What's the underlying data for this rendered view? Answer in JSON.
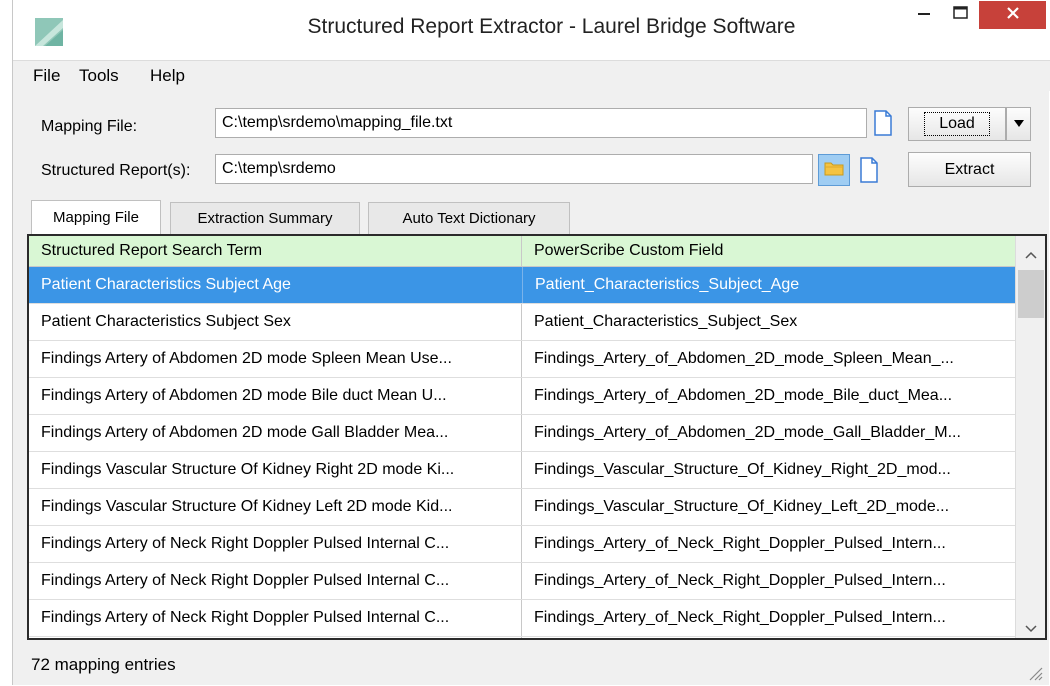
{
  "window": {
    "title": "Structured Report Extractor - Laurel Bridge Software",
    "icons": {
      "app": "laurel-bridge-logo-icon",
      "minimize": "minimize-icon",
      "maximize": "maximize-icon",
      "close": "close-icon"
    }
  },
  "menu": [
    "File",
    "Tools",
    "Help"
  ],
  "mapping_file": {
    "label": "Mapping File:",
    "value": "C:\\temp\\srdemo\\mapping_file.txt",
    "load_label": "Load"
  },
  "structured_reports": {
    "label": "Structured Report(s):",
    "value": "C:\\temp\\srdemo",
    "extract_label": "Extract"
  },
  "tabs": [
    "Mapping File",
    "Extraction Summary",
    "Auto Text Dictionary"
  ],
  "table": {
    "columns": [
      "Structured Report Search Term",
      "PowerScribe Custom Field"
    ],
    "rows": [
      [
        "Patient Characteristics Subject Age",
        "Patient_Characteristics_Subject_Age"
      ],
      [
        "Patient Characteristics Subject Sex",
        "Patient_Characteristics_Subject_Sex"
      ],
      [
        "Findings Artery of Abdomen  2D mode   Spleen Mean Use...",
        "Findings_Artery_of_Abdomen_2D_mode_Spleen_Mean_..."
      ],
      [
        "Findings Artery of Abdomen  2D mode   Bile duct Mean U...",
        "Findings_Artery_of_Abdomen_2D_mode_Bile_duct_Mea..."
      ],
      [
        "Findings Artery of Abdomen  2D mode   Gall Bladder Mea...",
        "Findings_Artery_of_Abdomen_2D_mode_Gall_Bladder_M..."
      ],
      [
        "Findings Vascular Structure Of Kidney Right  2D mode   Ki...",
        "Findings_Vascular_Structure_Of_Kidney_Right_2D_mod..."
      ],
      [
        "Findings Vascular Structure Of Kidney Left 2D mode   Kid...",
        "Findings_Vascular_Structure_Of_Kidney_Left_2D_mode..."
      ],
      [
        "Findings Artery of Neck Right  Doppler Pulsed  Internal C...",
        "Findings_Artery_of_Neck_Right_Doppler_Pulsed_Intern..."
      ],
      [
        "Findings Artery of Neck Right  Doppler Pulsed  Internal C...",
        "Findings_Artery_of_Neck_Right_Doppler_Pulsed_Intern..."
      ],
      [
        "Findings Artery of Neck Right  Doppler Pulsed  Internal C...",
        "Findings_Artery_of_Neck_Right_Doppler_Pulsed_Intern..."
      ]
    ],
    "selected_row": 0
  },
  "status": "72 mapping entries",
  "colors": {
    "header_bg": "#d9f7d4",
    "selection": "#3b95e6",
    "close_button": "#c7413a"
  }
}
